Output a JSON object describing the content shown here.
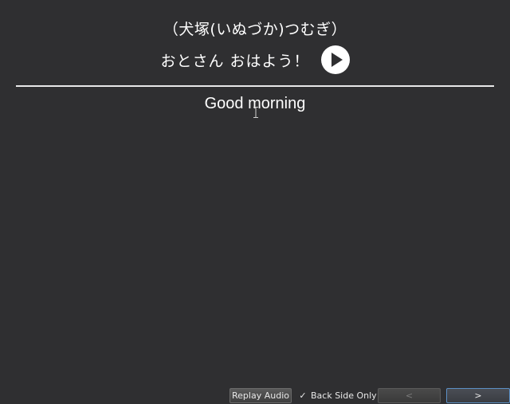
{
  "card": {
    "speaker": "（犬塚(いぬづか)つむぎ）",
    "question": "おとさん おはよう！",
    "answer": "Good morning"
  },
  "toolbar": {
    "replay_label": "Replay Audio",
    "back_side_only_label": "Back Side Only",
    "back_side_only_checked": "✓",
    "prev_label": "<",
    "next_label": ">"
  },
  "icons": {
    "play": "play-icon"
  }
}
